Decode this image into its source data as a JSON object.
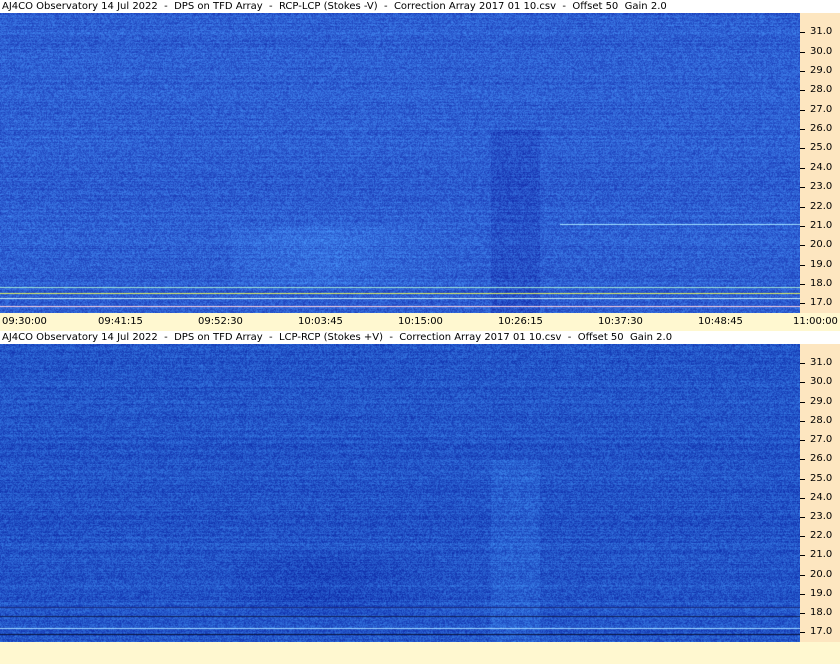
{
  "panels": [
    {
      "title": "AJ4CO Observatory 14 Jul 2022  -  DPS on TFD Array  -  RCP-LCP (Stokes -V)  -  Correction Array 2017 01 10.csv  -  Offset 50  Gain 2.0",
      "polarity": "RCP-LCP (Stokes -V)"
    },
    {
      "title": "AJ4CO Observatory 14 Jul 2022  -  DPS on TFD Array  -  LCP-RCP (Stokes +V)  -  Correction Array 2017 01 10.csv  -  Offset 50  Gain 2.0",
      "polarity": "LCP-RCP (Stokes +V)"
    }
  ],
  "colors": {
    "spectro_base": "#2f5fd2",
    "spectro_dark": "#1e3fae",
    "spectro_light": "#4f8af0",
    "cyan_line": "#80e8e0",
    "freq_axis_bg": "#fde6c0",
    "time_axis_bg": "#fff8d0"
  },
  "chart_data": {
    "type": "heatmap",
    "freq_axis": {
      "unit": "MHz",
      "range": [
        16.5,
        32.0
      ],
      "ticks": [
        "31.0",
        "30.0",
        "29.0",
        "28.0",
        "27.0",
        "26.0",
        "25.0",
        "24.0",
        "23.0",
        "22.0",
        "21.0",
        "20.0",
        "19.0",
        "18.0",
        "17.0"
      ]
    },
    "time_axis": {
      "range": [
        "09:30:00",
        "11:00:00"
      ],
      "ticks": [
        "09:30:00",
        "09:41:15",
        "09:52:30",
        "10:03:45",
        "10:15:00",
        "10:26:15",
        "10:37:30",
        "10:48:45",
        "11:00:00"
      ]
    },
    "series": [
      {
        "name": "RCP-LCP (Stokes -V)"
      },
      {
        "name": "LCP-RCP (Stokes +V)"
      }
    ]
  }
}
